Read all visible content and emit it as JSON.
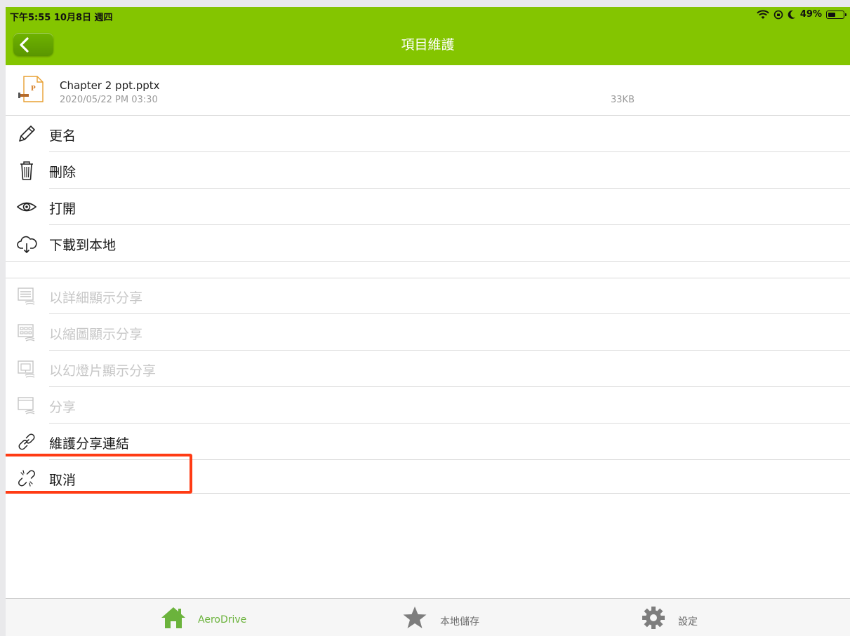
{
  "status_bar": {
    "time_date": "下午5:55   10月8日 週四",
    "battery": "49%"
  },
  "nav": {
    "title": "項目維護"
  },
  "file": {
    "name": "Chapter 2 ppt.pptx",
    "date": "2020/05/22 PM 03:30",
    "size": "33KB",
    "icon_letter": "P"
  },
  "menu": {
    "rename": "更名",
    "delete": "刪除",
    "open": "打開",
    "download": "下載到本地",
    "share_detail": "以詳細顯示分享",
    "share_thumb": "以縮圖顯示分享",
    "share_slide": "以幻燈片顯示分享",
    "share": "分享",
    "manage_link": "維護分享連結",
    "cancel": "取消"
  },
  "tabs": {
    "aerodrive": "AeroDrive",
    "local": "本地儲存",
    "settings": "設定"
  },
  "colors": {
    "accent": "#84c500",
    "highlight": "#ff3b14",
    "disabled": "#c7c7c7"
  }
}
